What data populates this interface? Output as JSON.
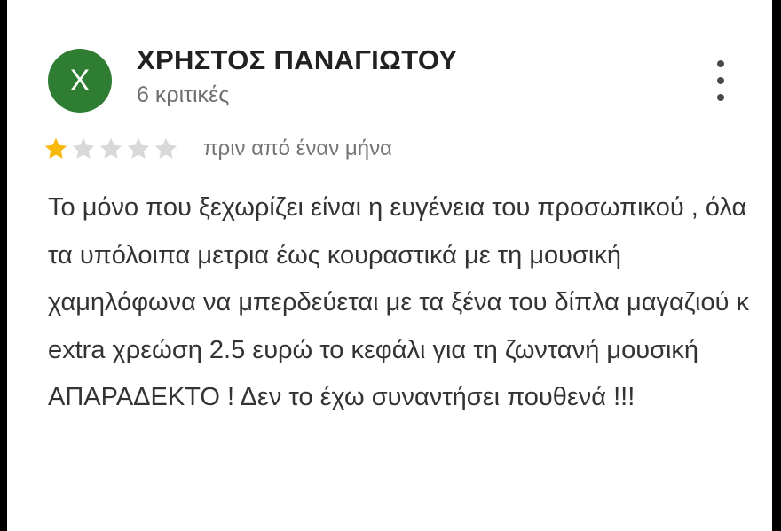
{
  "review": {
    "author": {
      "initial": "Χ",
      "name": "ΧΡΗΣΤΟΣ ΠΑΝΑΓΙΩΤΟΥ",
      "reviews_count_label": "6 κριτικές",
      "avatar_color": "#2e7d32"
    },
    "rating": 1,
    "max_rating": 5,
    "star_filled_color": "#f9b90a",
    "star_empty_color": "#d9d9d9",
    "date": "πριν από έναν μήνα",
    "more_icon": "more-vert-icon",
    "text": "Το μόνο που ξεχωρίζει είναι η ευγένεια του προσωπικού , όλα τα υπόλοιπα μετρια έως κουραστικά με τη μουσική χαμηλόφωνα να μπερδεύεται με τα ξένα του δίπλα μαγαζιού κ extra χρεώση 2.5 ευρώ το κεφάλι για τη ζωντανή μουσική ΑΠΑΡΑΔΕΚΤΟ ! Δεν το έχω συναντήσει πουθενά !!!"
  }
}
